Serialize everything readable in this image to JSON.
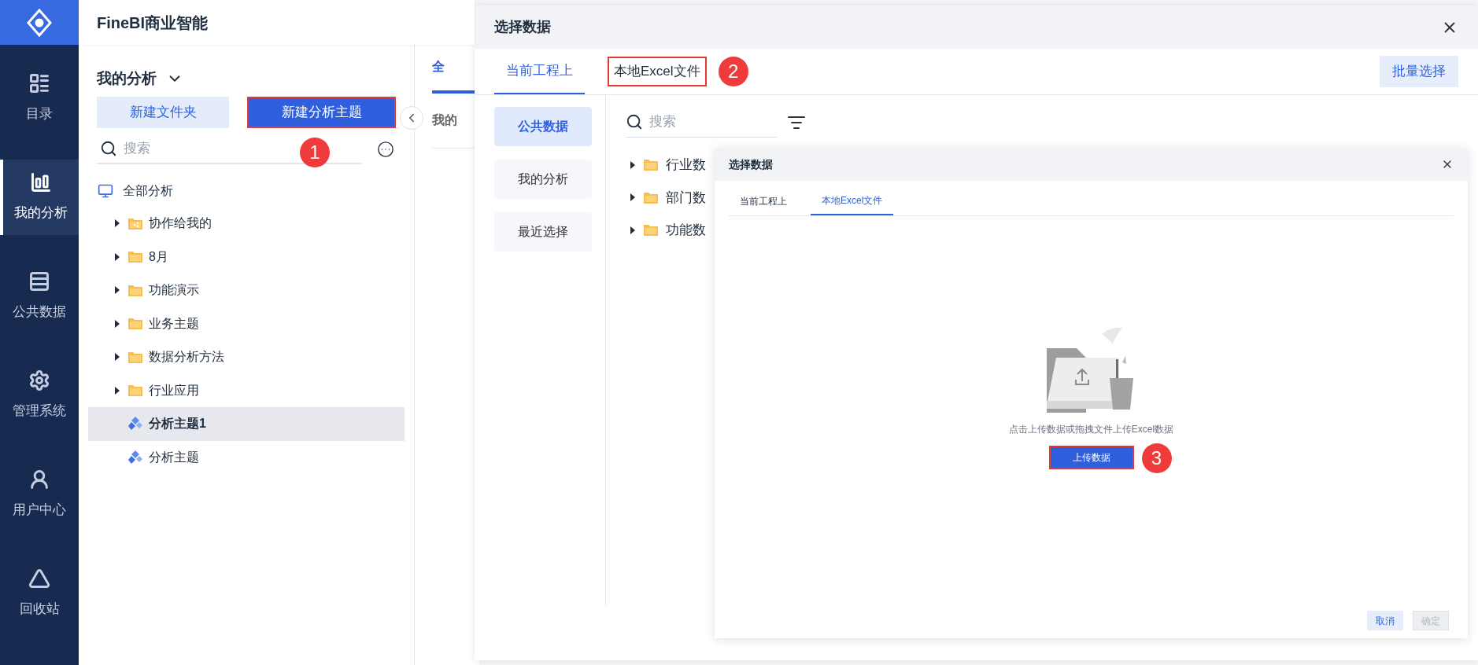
{
  "nav": {
    "items": [
      {
        "label": "目录",
        "selected": false
      },
      {
        "label": "我的分析",
        "selected": true
      },
      {
        "label": "公共数据",
        "selected": false
      },
      {
        "label": "管理系统",
        "selected": false
      },
      {
        "label": "用户中心",
        "selected": false
      },
      {
        "label": "回收站",
        "selected": false
      }
    ]
  },
  "app_title": "FineBI商业智能",
  "sidebar": {
    "title": "我的分析",
    "buttons": [
      {
        "label": "新建文件夹",
        "kind": "secondary",
        "highlighted": false
      },
      {
        "label": "新建分析主题",
        "kind": "primary",
        "highlighted": true,
        "callout": "1"
      }
    ],
    "search": {
      "placeholder": "搜索"
    },
    "tree": {
      "label": "全部分析",
      "children": [
        {
          "label": "协作给我的",
          "kind": "shared-folder",
          "selected": false
        },
        {
          "label": "8月",
          "kind": "folder",
          "selected": false
        },
        {
          "label": "功能演示",
          "kind": "folder",
          "selected": false
        },
        {
          "label": "业务主题",
          "kind": "folder",
          "selected": false
        },
        {
          "label": "数据分析方法",
          "kind": "folder",
          "selected": false
        },
        {
          "label": "行业应用",
          "kind": "folder",
          "selected": false
        },
        {
          "label": "分析主题1",
          "kind": "subject",
          "selected": true
        },
        {
          "label": "分析主题",
          "kind": "subject",
          "selected": false
        }
      ]
    }
  },
  "main_tabs": [
    {
      "label": "全",
      "selected": true
    },
    {
      "label": "我的",
      "selected": false
    }
  ],
  "dialog": {
    "title": "选择数据",
    "tabs": [
      {
        "label": "当前工程上",
        "selected": true,
        "highlighted": false
      },
      {
        "label": "本地Excel文件",
        "selected": false,
        "highlighted": true,
        "callout": "2"
      }
    ],
    "batch_button": "批量选择",
    "sources": [
      {
        "label": "公共数据",
        "selected": true
      },
      {
        "label": "我的分析",
        "selected": false
      },
      {
        "label": "最近选择",
        "selected": false
      }
    ],
    "search": {
      "placeholder": "搜索"
    },
    "folders": [
      "行业数",
      "部门数",
      "功能数"
    ]
  },
  "upload_dialog": {
    "title": "选择数据",
    "tabs": [
      {
        "label": "当前工程上",
        "selected": false
      },
      {
        "label": "本地Excel文件",
        "selected": true
      }
    ],
    "hint": "点击上传数据或拖拽文件上传Excel数据",
    "upload_button": {
      "label": "上传数据",
      "highlighted": true,
      "callout": "3"
    },
    "buttons": [
      {
        "label": "取消",
        "disabled": false
      },
      {
        "label": "确定",
        "disabled": true
      }
    ]
  }
}
